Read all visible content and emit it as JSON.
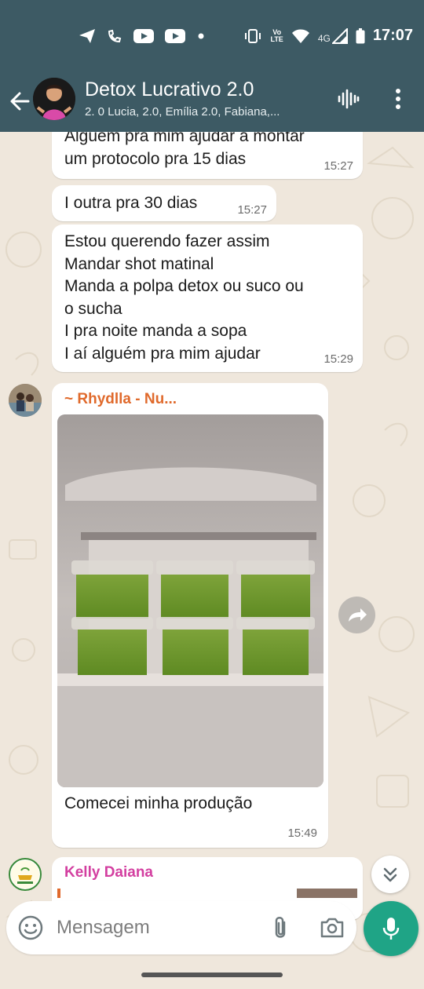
{
  "status_bar": {
    "time": "17:07",
    "volte_top": "Vo",
    "volte_bottom": "LTE",
    "network": "4G",
    "icons": [
      "send-icon",
      "missed-call-icon",
      "youtube-icon",
      "youtube-icon",
      "dot-icon",
      "vibrate-icon",
      "volte-icon",
      "wifi-icon",
      "signal-icon",
      "battery-icon"
    ]
  },
  "header": {
    "title": "Detox Lucrativo 2.0",
    "participants": "2. 0 Lucia, 2.0, Emília 2.0, Fabiana,...",
    "colors": {
      "bar": "#3d5a64"
    }
  },
  "messages": [
    {
      "text": "Alguem pra mim ajudar a montar\num protocolo pra 15 dias",
      "time": "15:27"
    },
    {
      "text": "I outra pra 30 dias",
      "time": "15:27"
    },
    {
      "text": "Estou querendo fazer assim\nMandar shot matinal\nManda a polpa detox ou suco ou\no sucha\nI pra noite manda a sopa\nI aí alguém pra mim ajudar",
      "time": "15:29"
    },
    {
      "sender": "~ Rhydlla - Nu...",
      "caption": "Comecei minha produção",
      "time": "15:49",
      "sender_color": "#e06a2c"
    },
    {
      "sender": "Kelly Daiana",
      "sender_color": "#d33fa0"
    }
  ],
  "input": {
    "placeholder": "Mensagem"
  },
  "colors": {
    "accent": "#1fa486",
    "wallpaper": "#efe7dc",
    "bubble": "#ffffff"
  }
}
